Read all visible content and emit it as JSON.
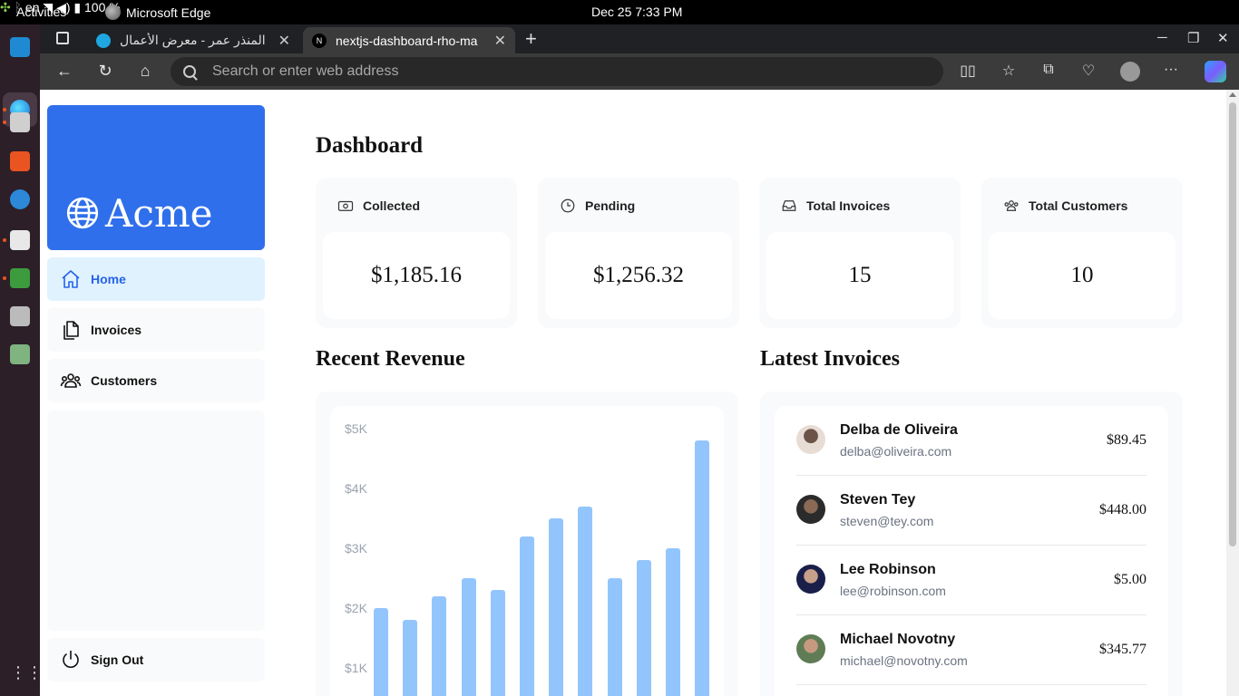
{
  "system": {
    "activities": "Activities",
    "app_name": "Microsoft Edge",
    "clock": "Dec 25  7:33 PM",
    "lang": "en",
    "battery": "100 %"
  },
  "browser": {
    "tabs": [
      {
        "title": "المنذر عمر - معرض الأعمال",
        "active": false
      },
      {
        "title": "nextjs-dashboard-rho-ma",
        "active": true
      }
    ],
    "address_placeholder": "Search or enter web address"
  },
  "sidenav": {
    "brand": "Acme",
    "items": [
      {
        "label": "Home",
        "icon": "home-icon",
        "active": true
      },
      {
        "label": "Invoices",
        "icon": "document-icon",
        "active": false
      },
      {
        "label": "Customers",
        "icon": "users-icon",
        "active": false
      }
    ],
    "sign_out": "Sign Out"
  },
  "dashboard": {
    "title": "Dashboard",
    "cards": [
      {
        "label": "Collected",
        "value": "$1,185.16",
        "icon": "banknote-icon"
      },
      {
        "label": "Pending",
        "value": "$1,256.32",
        "icon": "clock-icon"
      },
      {
        "label": "Total Invoices",
        "value": "15",
        "icon": "inbox-icon"
      },
      {
        "label": "Total Customers",
        "value": "10",
        "icon": "users-icon"
      }
    ]
  },
  "revenue": {
    "title": "Recent Revenue",
    "chart_data": {
      "type": "bar",
      "ytick_labels": [
        "$5K",
        "$4K",
        "$3K",
        "$2K",
        "$1K"
      ],
      "ylim": [
        0,
        5000
      ],
      "values": [
        2000,
        1800,
        2200,
        2500,
        2300,
        3200,
        3500,
        3700,
        2500,
        2800,
        3000,
        4800
      ],
      "bar_color": "#93c5fd"
    }
  },
  "latest_invoices": {
    "title": "Latest Invoices",
    "items": [
      {
        "name": "Delba de Oliveira",
        "email": "delba@oliveira.com",
        "amount": "$89.45"
      },
      {
        "name": "Steven Tey",
        "email": "steven@tey.com",
        "amount": "$448.00"
      },
      {
        "name": "Lee Robinson",
        "email": "lee@robinson.com",
        "amount": "$5.00"
      },
      {
        "name": "Michael Novotny",
        "email": "michael@novotny.com",
        "amount": "$345.77"
      }
    ]
  },
  "colors": {
    "brand": "#2f6feb",
    "active_nav_bg": "#e0f2fe",
    "active_nav_text": "#2563eb"
  }
}
